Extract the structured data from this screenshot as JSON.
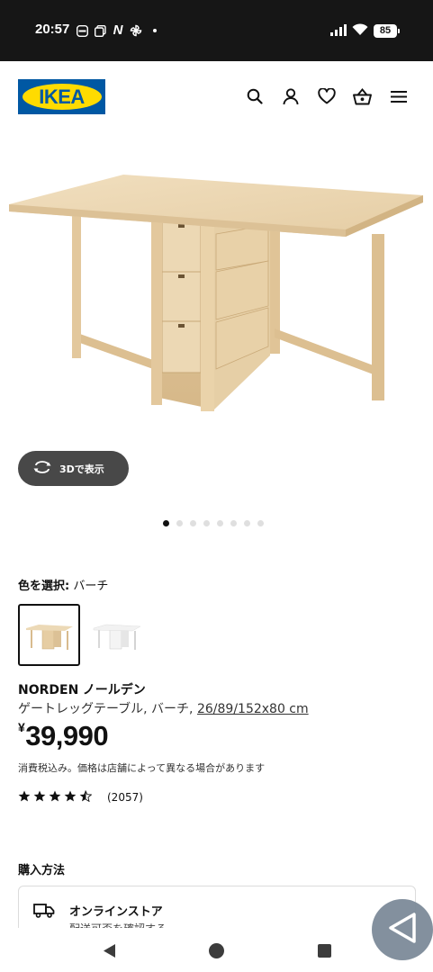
{
  "status_bar": {
    "time": "20:57",
    "battery": "85"
  },
  "header": {
    "logo_text": "IKEA",
    "brand_blue": "#0058a3",
    "brand_yellow": "#ffdb00",
    "icons": [
      "search-icon",
      "account-icon",
      "heart-icon",
      "cart-icon",
      "menu-icon"
    ]
  },
  "gallery": {
    "view_3d_label": "3Dで表示",
    "image_count": 8,
    "active_index": 0
  },
  "color_select": {
    "label": "色を選択:",
    "value": "バーチ",
    "swatches": [
      "birch",
      "white"
    ],
    "selected": 0
  },
  "product": {
    "name": "NORDEN",
    "name_jp": "ノールデン",
    "description": "ゲートレッグテーブル, バーチ, ",
    "dimensions": "26/89/152x80 cm",
    "currency": "¥",
    "price": "39,990",
    "tax_note": "消費税込み。価格は店舗によって異なる場合があります",
    "rating": 4.5,
    "review_count": "(2057)"
  },
  "purchase": {
    "title": "購入方法",
    "online_store": {
      "title": "オンラインストア",
      "subtitle": "配送可否を確認する"
    }
  }
}
